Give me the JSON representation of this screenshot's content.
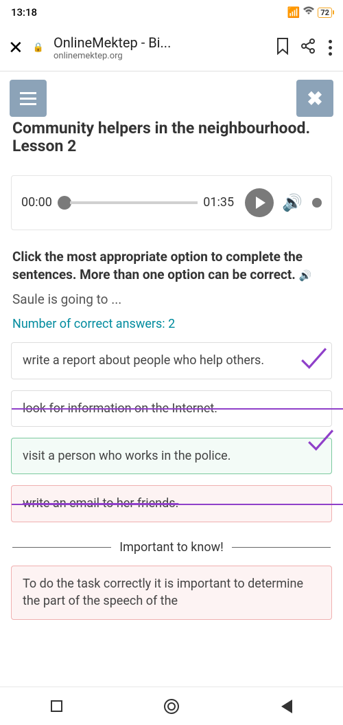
{
  "status": {
    "time": "13:18",
    "battery": "72"
  },
  "browser": {
    "title": "OnlineMektep - Bi...",
    "url": "onlinemektep.org"
  },
  "lesson": {
    "title": "Community helpers in the neighbourhood. Lesson 2"
  },
  "audio": {
    "current": "00:00",
    "total": "01:35"
  },
  "task": {
    "instruction": "Click the most appropriate option to complete the sentences. More than one option can be correct.",
    "stem": "Saule is going to ...",
    "correct_label": "Number of correct answers: 2",
    "options": [
      {
        "text": "write a report about people who help others."
      },
      {
        "text": "look for information on the Internet."
      },
      {
        "text": "visit a person who works in the police."
      },
      {
        "text": "write an email to her friends."
      }
    ]
  },
  "important": {
    "header": "Important to know!",
    "body": "To do the task correctly it is important to determine the part of the speech of the"
  }
}
